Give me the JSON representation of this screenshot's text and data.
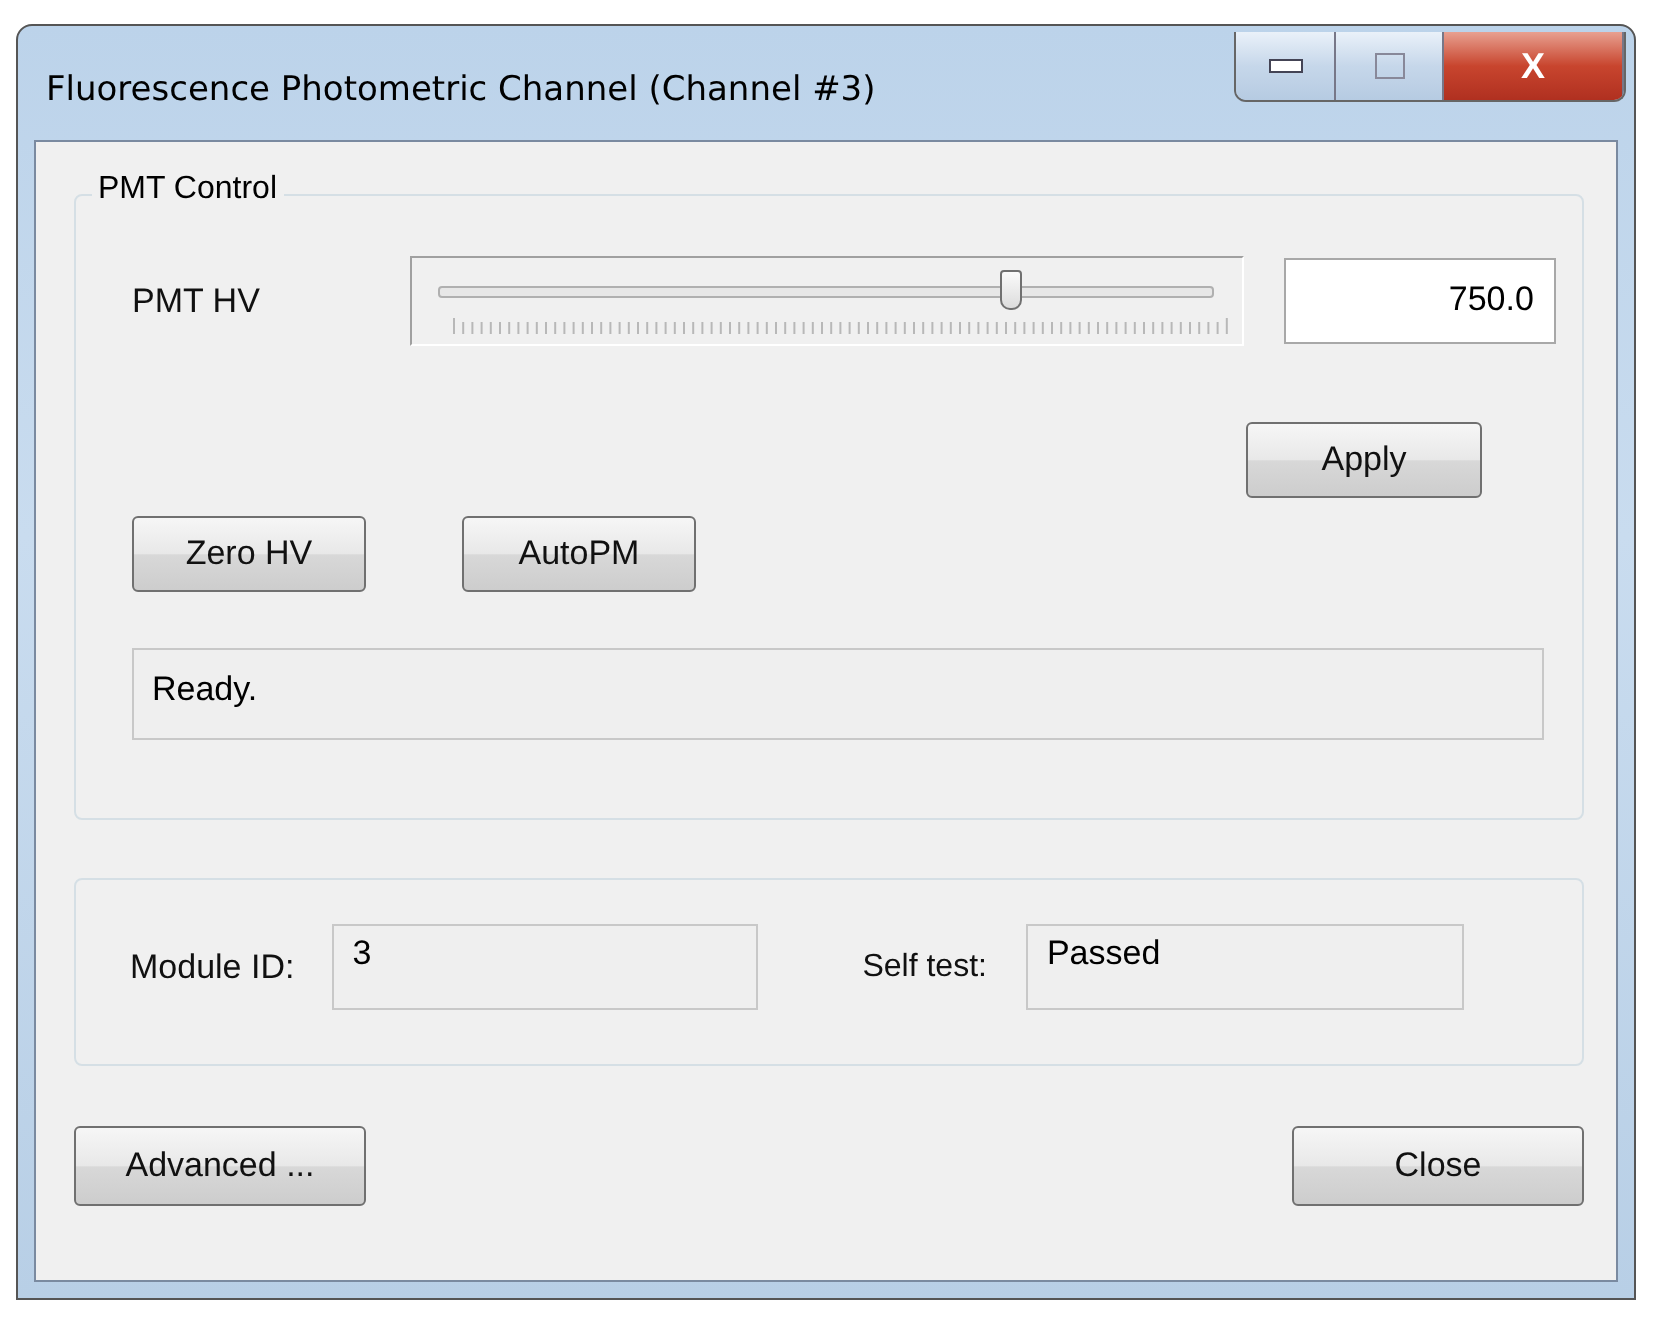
{
  "window": {
    "title": "Fluorescence Photometric Channel (Channel #3)",
    "close_glyph": "X"
  },
  "pmt_control": {
    "title": "PMT Control",
    "hv_label": "PMT HV",
    "hv_slider": {
      "level": 0.74
    },
    "hv_value": "750.0",
    "apply_button": "Apply",
    "buttons": [
      "Zero HV",
      "AutoPM"
    ],
    "status": "Ready."
  },
  "module": {
    "module_id_label": "Module ID:",
    "module_id": "3",
    "self_test_label": "Self test:",
    "self_test": "Passed"
  },
  "footer_buttons": [
    "Advanced ...",
    "Close"
  ]
}
